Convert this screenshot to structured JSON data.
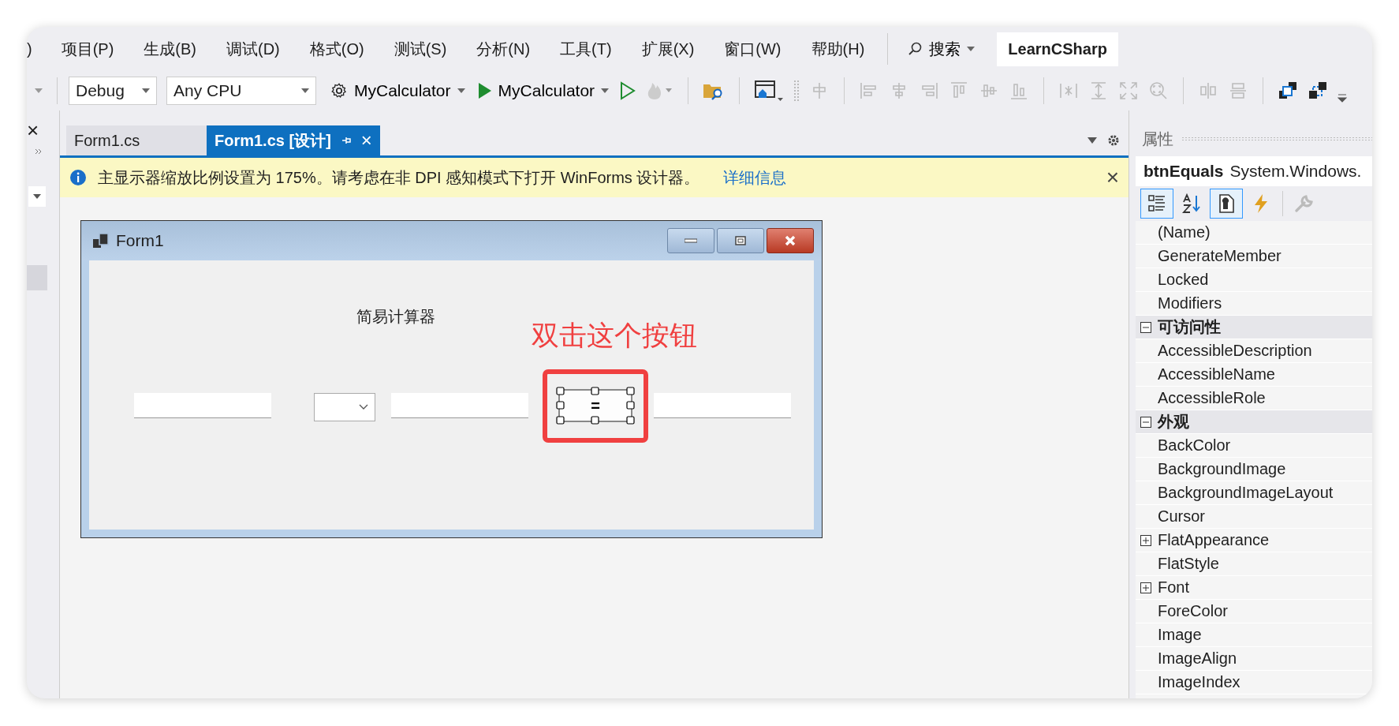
{
  "menu": {
    "cut_item": ")",
    "items": [
      "项目(P)",
      "生成(B)",
      "调试(D)",
      "格式(O)",
      "测试(S)",
      "分析(N)",
      "工具(T)",
      "扩展(X)",
      "窗口(W)",
      "帮助(H)"
    ],
    "search": "搜索",
    "solution": "LearnCSharp"
  },
  "toolbar": {
    "configuration": "Debug",
    "platform": "Any CPU",
    "startup_project": "MyCalculator",
    "run_target": "MyCalculator"
  },
  "left_strip": {
    "close": "×"
  },
  "tabs": [
    {
      "label": "Form1.cs",
      "selected": false
    },
    {
      "label": "Form1.cs [设计]",
      "selected": true
    }
  ],
  "tab_close": "×",
  "info_bar": {
    "message": "主显示器缩放比例设置为 175%。请考虑在非 DPI 感知模式下打开 WinForms 设计器。",
    "link": "详细信息",
    "close": "×"
  },
  "form": {
    "title": "Form1",
    "label": "简易计算器",
    "button": "=",
    "annotation": "双击这个按钮"
  },
  "properties": {
    "title": "属性",
    "object_name": "btnEquals",
    "object_type": "System.Windows.",
    "tools": [
      {
        "kind": "categorized",
        "selected": true
      },
      {
        "kind": "alphabetical",
        "selected": false
      },
      {
        "kind": "properties",
        "selected": true
      },
      {
        "kind": "events",
        "selected": false
      },
      {
        "kind": "pages",
        "selected": false
      }
    ],
    "rows": [
      {
        "label": "(Name)",
        "kind": "property"
      },
      {
        "label": "GenerateMember",
        "kind": "property"
      },
      {
        "label": "Locked",
        "kind": "property"
      },
      {
        "label": "Modifiers",
        "kind": "property"
      },
      {
        "label": "可访问性",
        "kind": "category",
        "expanded": true
      },
      {
        "label": "AccessibleDescription",
        "kind": "property"
      },
      {
        "label": "AccessibleName",
        "kind": "property"
      },
      {
        "label": "AccessibleRole",
        "kind": "property"
      },
      {
        "label": "外观",
        "kind": "category",
        "expanded": true
      },
      {
        "label": "BackColor",
        "kind": "property"
      },
      {
        "label": "BackgroundImage",
        "kind": "property"
      },
      {
        "label": "BackgroundImageLayout",
        "kind": "property"
      },
      {
        "label": "Cursor",
        "kind": "property"
      },
      {
        "label": "FlatAppearance",
        "kind": "group",
        "expanded": false
      },
      {
        "label": "FlatStyle",
        "kind": "property"
      },
      {
        "label": "Font",
        "kind": "group",
        "expanded": false
      },
      {
        "label": "ForeColor",
        "kind": "property"
      },
      {
        "label": "Image",
        "kind": "property"
      },
      {
        "label": "ImageAlign",
        "kind": "property"
      },
      {
        "label": "ImageIndex",
        "kind": "property"
      }
    ]
  }
}
